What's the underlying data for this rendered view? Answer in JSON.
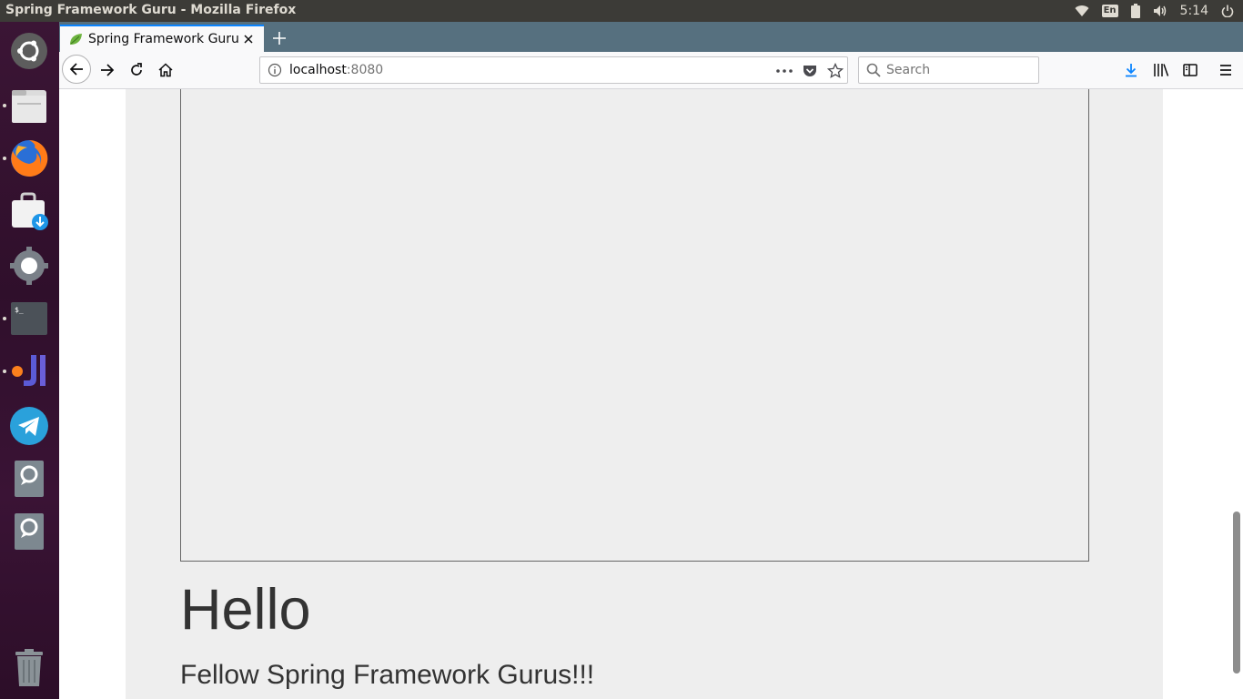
{
  "system": {
    "window_title": "Spring Framework Guru - Mozilla Firefox",
    "keyboard_layout": "En",
    "clock": "5:14",
    "tray_icons": [
      "wifi-icon",
      "keyboard-layout-icon",
      "battery-icon",
      "volume-icon",
      "power-icon"
    ]
  },
  "launcher": {
    "items": [
      {
        "name": "ubuntu-dash-icon"
      },
      {
        "name": "files-icon"
      },
      {
        "name": "firefox-icon"
      },
      {
        "name": "software-center-icon"
      },
      {
        "name": "settings-icon"
      },
      {
        "name": "terminal-icon"
      },
      {
        "name": "intellij-icon"
      },
      {
        "name": "telegram-icon"
      },
      {
        "name": "drive-icon"
      },
      {
        "name": "drive-icon"
      },
      {
        "name": "trash-icon"
      }
    ]
  },
  "browser": {
    "tab": {
      "title": "Spring Framework Guru",
      "favicon": "spring-leaf-icon"
    },
    "url": {
      "host": "localhost",
      "port": ":8080"
    },
    "search": {
      "placeholder": "Search"
    },
    "accent": "#0a84ff",
    "tabbar_color": "#56707f"
  },
  "page": {
    "heading": "Hello",
    "subheading": "Fellow Spring Framework Gurus!!!",
    "background": "#eeeeee"
  }
}
